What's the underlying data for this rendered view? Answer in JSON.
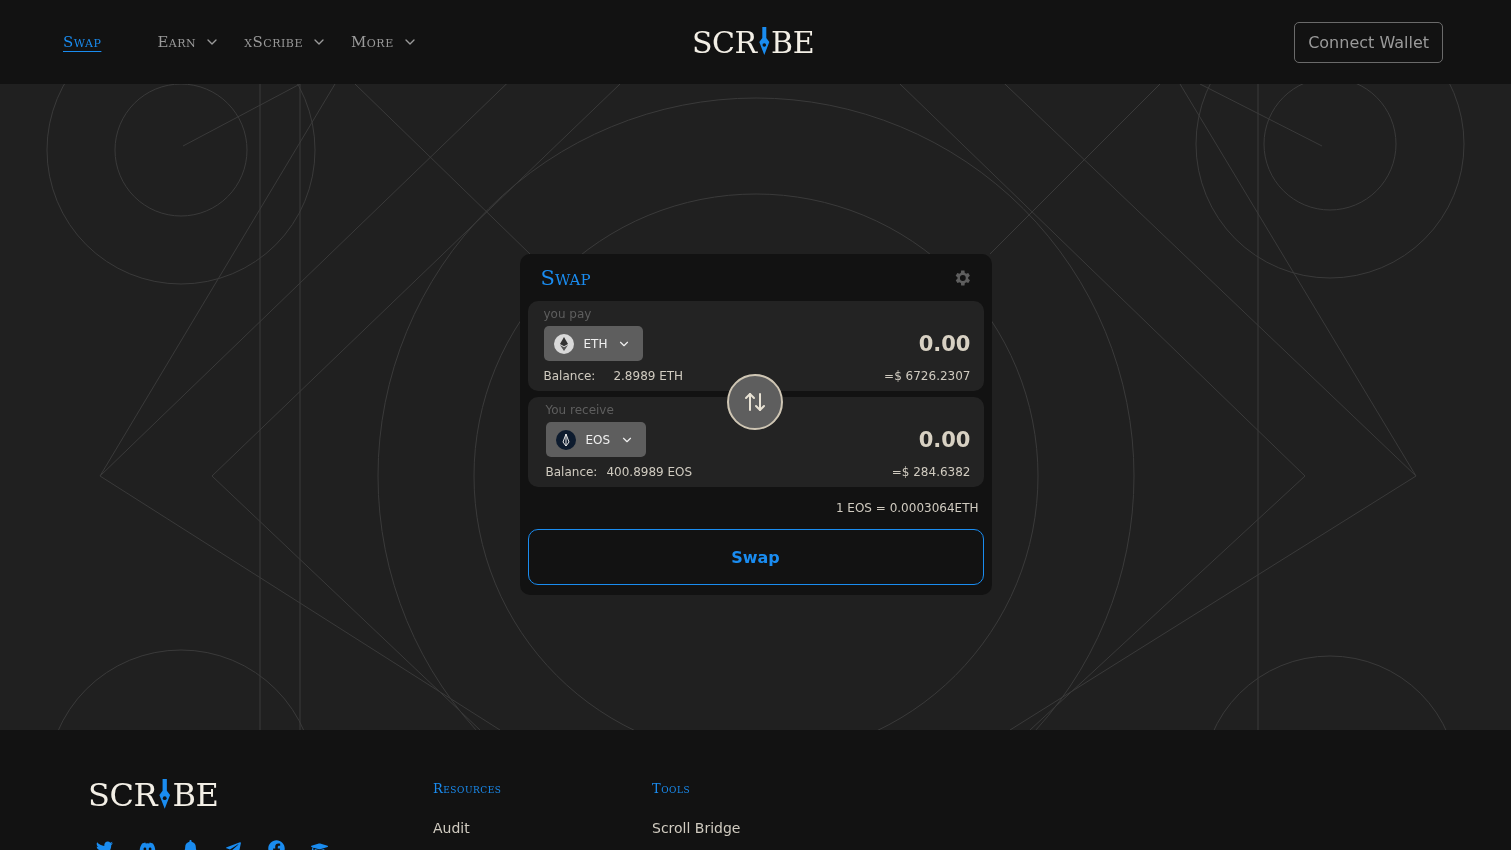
{
  "nav": {
    "items": [
      {
        "label": "Swap",
        "selected": true,
        "dropdown": false
      },
      {
        "label": "Earn",
        "selected": false,
        "dropdown": true
      },
      {
        "label": "xScribe",
        "selected": false,
        "dropdown": true
      },
      {
        "label": "More",
        "selected": false,
        "dropdown": true
      }
    ],
    "logo": {
      "before": "SCR",
      "after": "BE"
    },
    "connect_button": "Connect Wallet"
  },
  "swap_card": {
    "title": "Swap",
    "pay": {
      "label": "you pay",
      "token": "ETH",
      "amount": "0.00",
      "balance_label": "Balance:",
      "balance": "2.8989 ETH",
      "usd": "=$ 6726.2307"
    },
    "receive": {
      "label": "You receive",
      "token": "EOS",
      "amount": "0.00",
      "balance_label": "Balance:",
      "balance": "400.8989 EOS",
      "usd": "=$ 284.6382"
    },
    "rate": "1 EOS = 0.0003064ETH",
    "button": "Swap"
  },
  "footer": {
    "logo": {
      "before": "SCR",
      "after": "BE"
    },
    "columns": [
      {
        "heading": "Resources",
        "links": [
          "Audit"
        ]
      },
      {
        "heading": "Tools",
        "links": [
          "Scroll Bridge"
        ]
      }
    ]
  }
}
